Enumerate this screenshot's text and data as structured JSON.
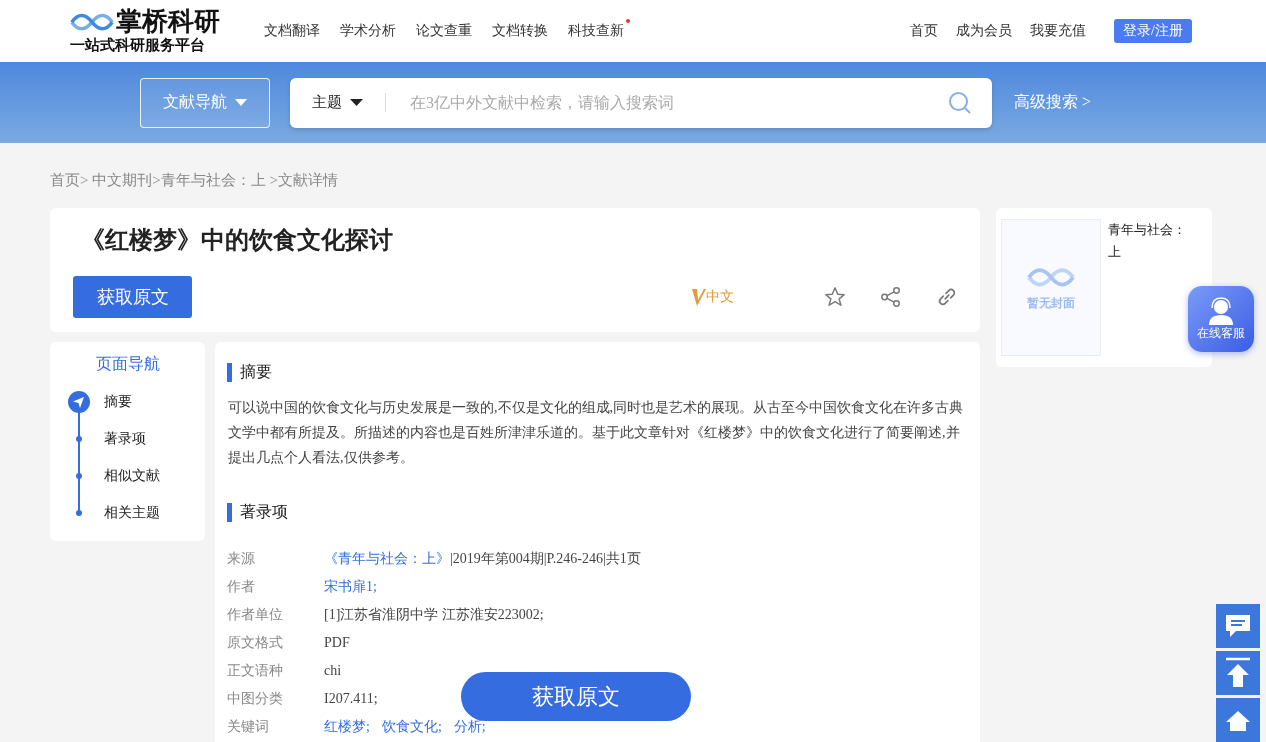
{
  "header": {
    "logo_title": "掌桥科研",
    "logo_subtitle": "一站式科研服务平台",
    "nav": [
      {
        "label": "文档翻译",
        "dot": false
      },
      {
        "label": "学术分析",
        "dot": false
      },
      {
        "label": "论文查重",
        "dot": false
      },
      {
        "label": "文档转换",
        "dot": false
      },
      {
        "label": "科技查新",
        "dot": true
      }
    ],
    "links": [
      "首页",
      "成为会员",
      "我要充值"
    ],
    "login": "登录/注册"
  },
  "search": {
    "nav_button": "文献导航",
    "scope": "主题",
    "placeholder": "在3亿中外文献中检索，请输入搜索词",
    "advanced": "高级搜索 >"
  },
  "breadcrumb": "首页> 中文期刊>青年与社会：上 >文献详情",
  "article": {
    "title": "《红楼梦》中的饮食文化探讨",
    "get_button": "获取原文",
    "lang_badge": "中文"
  },
  "page_nav": {
    "title": "页面导航",
    "items": [
      {
        "label": "摘要",
        "selected": true
      },
      {
        "label": "著录项",
        "selected": false
      },
      {
        "label": "相似文献",
        "selected": false
      },
      {
        "label": "相关主题",
        "selected": false
      }
    ]
  },
  "abstract": {
    "heading": "摘要",
    "text": "可以说中国的饮食文化与历史发展是一致的,不仅是文化的组成,同时也是艺术的展现。从古至今中国饮食文化在许多古典文学中都有所提及。所描述的内容也是百姓所津津乐道的。基于此文章针对《红楼梦》中的饮食文化进行了简要阐述,并提出几点个人看法,仅供参考。"
  },
  "record": {
    "heading": "著录项",
    "rows": [
      {
        "label": "来源",
        "parts": [
          {
            "text": "《青年与社会：上》",
            "link": true
          },
          {
            "text": "|2019年第004期|P.246-246|共1页",
            "link": false
          }
        ]
      },
      {
        "label": "作者",
        "parts": [
          {
            "text": "宋书扉1;",
            "link": true
          }
        ]
      },
      {
        "label": "作者单位",
        "parts": [
          {
            "text": "[1]江苏省淮阴中学 江苏淮安223002;",
            "link": false
          }
        ]
      },
      {
        "label": "原文格式",
        "parts": [
          {
            "text": "PDF",
            "link": false
          }
        ]
      },
      {
        "label": "正文语种",
        "parts": [
          {
            "text": "chi",
            "link": false
          }
        ]
      },
      {
        "label": "中图分类",
        "parts": [
          {
            "text": "I207.411;",
            "link": false
          }
        ]
      },
      {
        "label": "关键词",
        "parts": [
          {
            "text": "红楼梦;",
            "link": true
          },
          {
            "text": "饮食文化;",
            "link": true
          },
          {
            "text": "分析;",
            "link": true
          }
        ]
      }
    ]
  },
  "journal": {
    "cover_text": "暂无封面",
    "name": "青年与社会：上"
  },
  "service": {
    "label": "在线客服"
  },
  "floating_button": "获取原文"
}
